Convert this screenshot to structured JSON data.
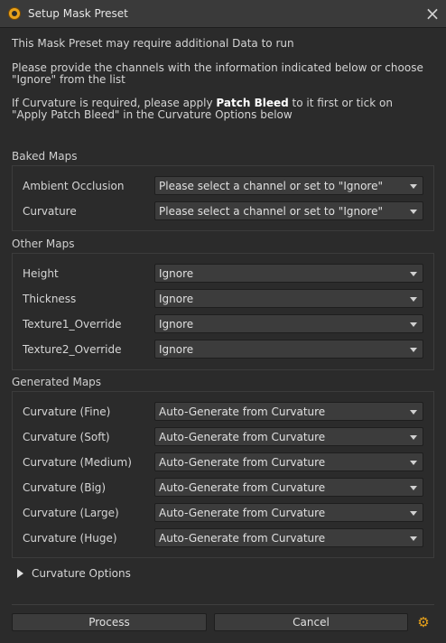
{
  "window": {
    "title": "Setup Mask Preset",
    "close_icon": "close-icon",
    "app_icon": "app-icon"
  },
  "info": {
    "line1": "This Mask Preset may require additional Data to run",
    "line2a": "Please provide the channels with the information indicated below or choose",
    "line2b": "\"Ignore\" from the list",
    "line3a_pre": "If Curvature is required, please apply ",
    "line3a_bold": "Patch Bleed",
    "line3a_post": " to it first or tick on",
    "line3b": "\"Apply Patch Bleed\" in the Curvature Options below"
  },
  "baked_maps": {
    "title": "Baked Maps",
    "rows": [
      {
        "label": "Ambient Occlusion",
        "value": "Please select a channel or set to \"Ignore\""
      },
      {
        "label": "Curvature",
        "value": "Please select a channel or set to \"Ignore\""
      }
    ]
  },
  "other_maps": {
    "title": "Other Maps",
    "rows": [
      {
        "label": "Height",
        "value": "Ignore"
      },
      {
        "label": "Thickness",
        "value": "Ignore"
      },
      {
        "label": "Texture1_Override",
        "value": "Ignore"
      },
      {
        "label": "Texture2_Override",
        "value": "Ignore"
      }
    ]
  },
  "generated_maps": {
    "title": "Generated Maps",
    "rows": [
      {
        "label": "Curvature (Fine)",
        "value": "Auto-Generate from Curvature"
      },
      {
        "label": "Curvature (Soft)",
        "value": "Auto-Generate from Curvature"
      },
      {
        "label": "Curvature (Medium)",
        "value": "Auto-Generate from Curvature"
      },
      {
        "label": "Curvature (Big)",
        "value": "Auto-Generate from Curvature"
      },
      {
        "label": "Curvature (Large)",
        "value": "Auto-Generate from Curvature"
      },
      {
        "label": "Curvature (Huge)",
        "value": "Auto-Generate from Curvature"
      }
    ]
  },
  "curvature_options": {
    "label": "Curvature Options",
    "expanded": false
  },
  "footer": {
    "process_label": "Process",
    "cancel_label": "Cancel",
    "settings_icon": "gear-icon"
  },
  "colors": {
    "accent": "#e8a21b",
    "background": "#2b2b2b",
    "dropdown": "#3c3c3c"
  }
}
